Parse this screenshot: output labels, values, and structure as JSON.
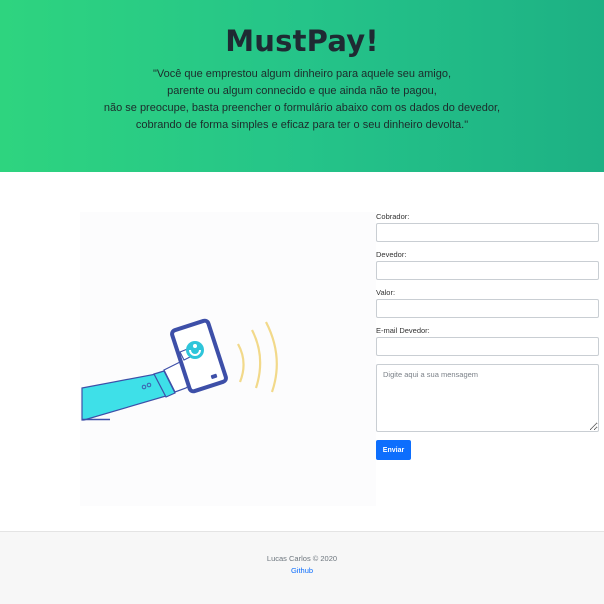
{
  "hero": {
    "title": "MustPay!",
    "quote_lines": [
      "\"Você que emprestou algum dinheiro para aquele seu amigo,",
      "parente ou algum connecido e que ainda não te pagou,",
      "não se preocupe, basta preencher o formulário abaixo com os dados do devedor,",
      "cobrando de forma simples e eficaz para ter o seu dinheiro devolta.\""
    ],
    "colors": {
      "gradient_start": "#2ed47f",
      "gradient_end": "#1db184"
    }
  },
  "illustration": {
    "icon": "hand-holding-phone-payment-icon",
    "colors": {
      "sleeve": "#3ee0e8",
      "phone": "#3d4fa8",
      "waves": "#f2d98a"
    }
  },
  "form": {
    "cobrador_label": "Cobrador:",
    "cobrador_value": "",
    "devedor_label": "Devedor:",
    "devedor_value": "",
    "valor_label": "Valor:",
    "valor_value": "",
    "email_label": "E-mail Devedor:",
    "email_value": "",
    "message_placeholder": "Digite aqui a sua mensagem",
    "submit_label": "Enviar",
    "colors": {
      "button": "#0d6efd"
    }
  },
  "footer": {
    "copyright": "Lucas Carlos © 2020",
    "github_link": "Github"
  }
}
